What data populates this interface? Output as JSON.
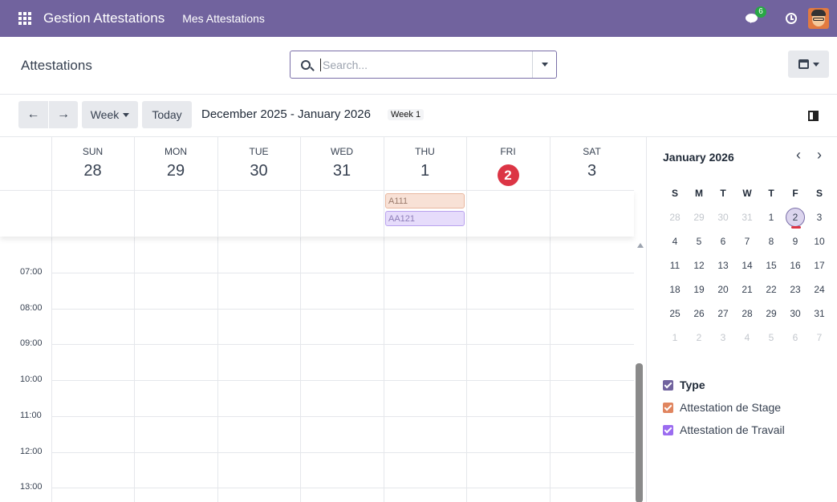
{
  "navbar": {
    "app_name": "Gestion Attestations",
    "menu_item": "Mes Attestations",
    "chat_badge": "6",
    "color": "#71639e"
  },
  "control": {
    "breadcrumb": "Attestations",
    "search_placeholder": "Search..."
  },
  "toolbar": {
    "prev_label": "←",
    "next_label": "→",
    "scale_label": "Week",
    "today_label": "Today",
    "range_title": "December 2025 - January 2026",
    "week_tag": "Week 1"
  },
  "days": [
    {
      "name": "SUN",
      "num": "28"
    },
    {
      "name": "MON",
      "num": "29"
    },
    {
      "name": "TUE",
      "num": "30"
    },
    {
      "name": "WED",
      "num": "31"
    },
    {
      "name": "THU",
      "num": "1"
    },
    {
      "name": "FRI",
      "num": "2"
    },
    {
      "name": "SAT",
      "num": "3"
    }
  ],
  "events": [
    {
      "label": "A111",
      "type": "stage",
      "day": "THU"
    },
    {
      "label": "AA121",
      "type": "travail",
      "day": "THU"
    }
  ],
  "hours": [
    "07:00",
    "08:00",
    "09:00",
    "10:00",
    "11:00",
    "12:00",
    "13:00"
  ],
  "mini_calendar": {
    "title": "January 2026",
    "prev": "‹",
    "next": "›",
    "weekday_heads": [
      "S",
      "M",
      "T",
      "W",
      "T",
      "F",
      "S"
    ],
    "weeks": [
      [
        "28",
        "29",
        "30",
        "31",
        "1",
        "2",
        "3"
      ],
      [
        "4",
        "5",
        "6",
        "7",
        "8",
        "9",
        "10"
      ],
      [
        "11",
        "12",
        "13",
        "14",
        "15",
        "16",
        "17"
      ],
      [
        "18",
        "19",
        "20",
        "21",
        "22",
        "23",
        "24"
      ],
      [
        "25",
        "26",
        "27",
        "28",
        "29",
        "30",
        "31"
      ],
      [
        "1",
        "2",
        "3",
        "4",
        "5",
        "6",
        "7"
      ]
    ]
  },
  "filters": {
    "heading": "Type",
    "items": [
      {
        "label": "Attestation de Stage",
        "color": "#e0855f"
      },
      {
        "label": "Attestation de Travail",
        "color": "#9b6cf0"
      }
    ],
    "heading_color": "#71639e"
  }
}
